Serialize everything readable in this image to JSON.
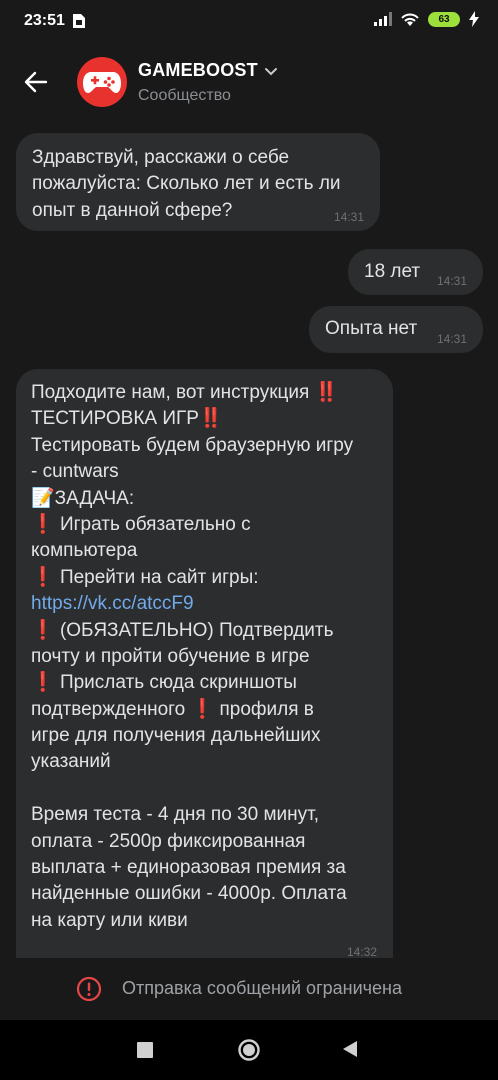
{
  "status_bar": {
    "time": "23:51",
    "battery": "63"
  },
  "header": {
    "title": "GAMEBOOST",
    "subtitle": "Сообщество"
  },
  "messages": [
    {
      "direction": "incoming",
      "lines": [
        "Здравствуй, расскажи о себе",
        "пожалуйста: Сколько лет и есть ли",
        "опыт в данной сфере?"
      ],
      "time": "14:31"
    },
    {
      "direction": "outgoing",
      "lines": [
        "18 лет"
      ],
      "time": "14:31"
    },
    {
      "direction": "outgoing",
      "lines": [
        "Опыта нет"
      ],
      "time": "14:31"
    },
    {
      "direction": "incoming",
      "lines": [
        "Подходите нам, вот инструкция",
        "ТЕСТИРОВКА ИГР",
        "Тестировать будем браузерную игру",
        "- cuntwars",
        "ЗАДАЧА:",
        "Играть обязательно с",
        "компьютера",
        "Перейти на сайт игры:",
        "https://vk.cc/atccF9",
        "(ОБЯЗАТЕЛЬНО) Подтвердить",
        "почту и пройти обучение в игре",
        "Прислать сюда скриншоты",
        "подтвержденного",
        "профиля в",
        "игре для получения дальнейших",
        "указаний",
        "Время теста - 4 дня по 30 минут,",
        "оплата - 2500р фиксированная",
        "выплата + единоразовая премия за",
        "найденные ошибки - 4000р. Оплата",
        "на карту или киви"
      ],
      "time": "14:32"
    }
  ],
  "emoji": {
    "double_exclamation": "‼️",
    "exclamation": "❗",
    "memo": "📝"
  },
  "footer": {
    "notice": "Отправка сообщений ограничена"
  },
  "colors": {
    "background": "#191919",
    "bubble": "#2c2d2e",
    "link": "#71aaeb",
    "alert": "#e64646",
    "avatar": "#e8322d"
  }
}
